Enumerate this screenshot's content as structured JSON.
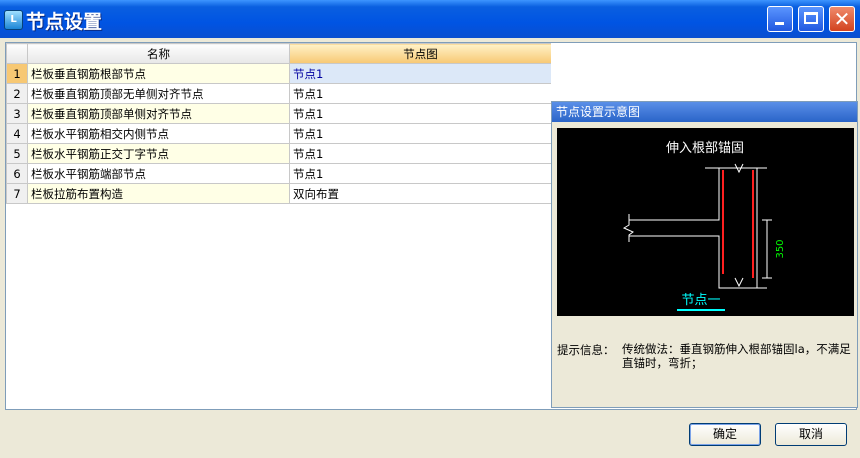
{
  "window": {
    "title": "节点设置",
    "icon_text": "L"
  },
  "grid": {
    "columns": [
      "名称",
      "节点图"
    ],
    "rows": [
      {
        "num": "1",
        "name": "栏板垂直钢筋根部节点",
        "value": "节点1"
      },
      {
        "num": "2",
        "name": "栏板垂直钢筋顶部无单侧对齐节点",
        "value": "节点1"
      },
      {
        "num": "3",
        "name": "栏板垂直钢筋顶部单侧对齐节点",
        "value": "节点1"
      },
      {
        "num": "4",
        "name": "栏板水平钢筋相交内侧节点",
        "value": "节点1"
      },
      {
        "num": "5",
        "name": "栏板水平钢筋正交丁字节点",
        "value": "节点1"
      },
      {
        "num": "6",
        "name": "栏板水平钢筋端部节点",
        "value": "节点1"
      },
      {
        "num": "7",
        "name": "栏板拉筋布置构造",
        "value": "双向布置"
      }
    ]
  },
  "preview": {
    "header": "节点设置示意图",
    "diagram_title": "伸入根部锚固",
    "dimension": "350",
    "node_label": "节点一",
    "hint_label": "提示信息：",
    "hint_text": "传统做法：垂直钢筋伸入根部锚固la，不满足直锚时，弯折；",
    "colors": {
      "canvas": "#000000",
      "rebar": "#ff2020",
      "dimension": "#00ff00",
      "label": "#00ffff"
    }
  },
  "buttons": {
    "ok": "确定",
    "cancel": "取消"
  }
}
